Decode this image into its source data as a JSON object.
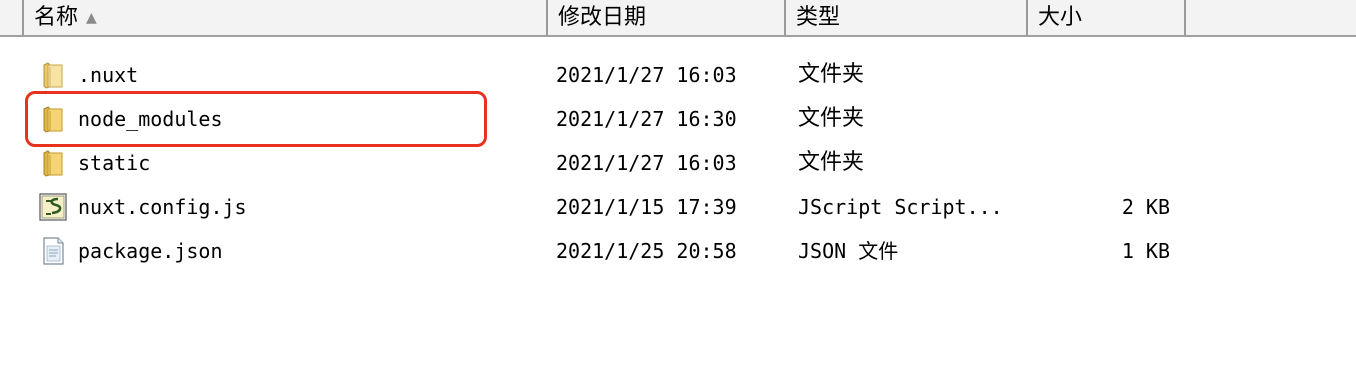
{
  "columns": {
    "name": "名称",
    "date": "修改日期",
    "type": "类型",
    "size": "大小"
  },
  "sort_indicator": "▲",
  "files": [
    {
      "name": ".nuxt",
      "date": "2021/1/27 16:03",
      "type": "文件夹",
      "size": "",
      "icon": "folder-icon"
    },
    {
      "name": "node_modules",
      "date": "2021/1/27 16:30",
      "type": "文件夹",
      "size": "",
      "icon": "folder-icon"
    },
    {
      "name": "static",
      "date": "2021/1/27 16:03",
      "type": "文件夹",
      "size": "",
      "icon": "folder-icon"
    },
    {
      "name": "nuxt.config.js",
      "date": "2021/1/15 17:39",
      "type": "JScript Script...",
      "size": "2 KB",
      "icon": "script-file-icon"
    },
    {
      "name": "package.json",
      "date": "2021/1/25 20:58",
      "type": "JSON 文件",
      "size": "1 KB",
      "icon": "json-file-icon"
    }
  ],
  "highlight_color": "#e8321f"
}
